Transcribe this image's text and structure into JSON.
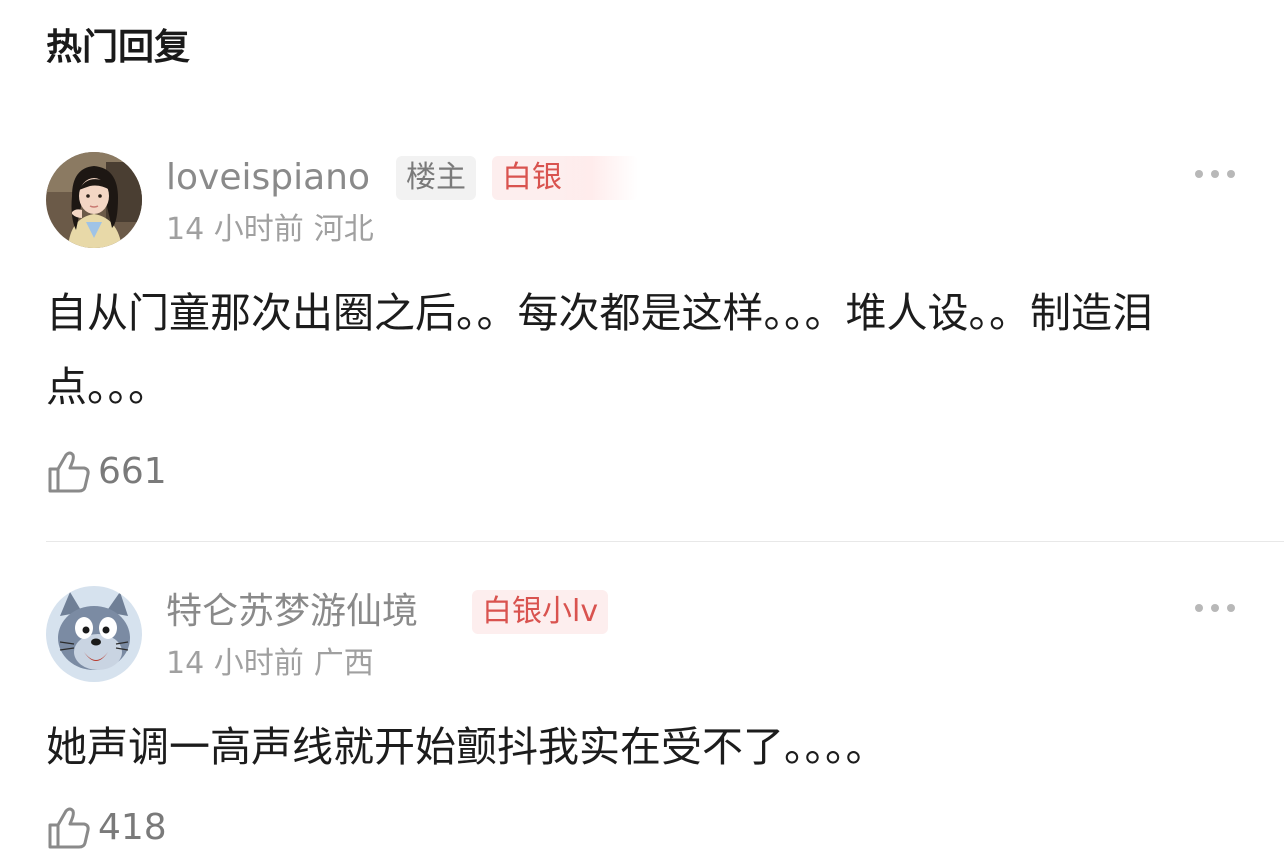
{
  "section": {
    "title": "热门回复"
  },
  "comments": [
    {
      "username": "loveispiano",
      "op_badge": "楼主",
      "level_badge": "白银",
      "time": "14 小时前",
      "location": "河北",
      "text": "自从门童那次出圈之后。。每次都是这样。。。堆人设。。制造泪点。。。",
      "likes": "661",
      "avatar_icon": "girl-portrait-avatar",
      "more_icon": "more-dots-icon",
      "like_icon": "thumbs-up-icon"
    },
    {
      "username": "特仑苏梦游仙境",
      "level_badge": "白银小lv",
      "time": "14 小时前",
      "location": "广西",
      "text": "她声调一高声线就开始颤抖我实在受不了。。。。",
      "likes": "418",
      "avatar_icon": "cartoon-cat-avatar",
      "more_icon": "more-dots-icon",
      "like_icon": "thumbs-up-icon"
    }
  ],
  "colors": {
    "badge_red": "#d9534f",
    "badge_red_bg": "#fdeeee",
    "meta_gray": "#a0a0a0",
    "username_gray": "#8a8a8a"
  }
}
